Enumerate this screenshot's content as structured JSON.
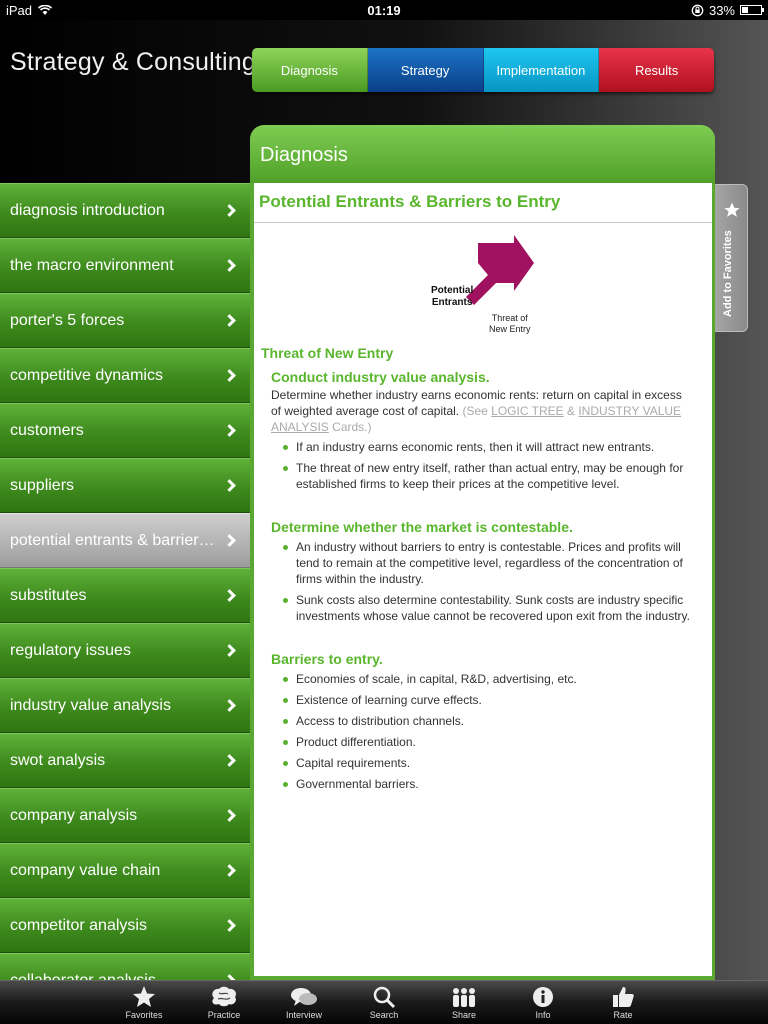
{
  "status": {
    "device": "iPad",
    "time": "01:19",
    "battery": "33%",
    "battery_level": 0.33
  },
  "header": {
    "title": "Strategy & Consulting"
  },
  "tabs": [
    {
      "label": "Diagnosis",
      "color": "green"
    },
    {
      "label": "Strategy",
      "color": "blue"
    },
    {
      "label": "Implementation",
      "color": "cyan"
    },
    {
      "label": "Results",
      "color": "red"
    }
  ],
  "panel": {
    "heading": "Diagnosis"
  },
  "sidebar": {
    "items": [
      {
        "label": "diagnosis introduction"
      },
      {
        "label": "the macro environment"
      },
      {
        "label": "porter's 5 forces"
      },
      {
        "label": "competitive dynamics"
      },
      {
        "label": "customers"
      },
      {
        "label": "suppliers"
      },
      {
        "label": "potential entrants & barrier…",
        "active": true
      },
      {
        "label": "substitutes"
      },
      {
        "label": "regulatory issues"
      },
      {
        "label": "industry value analysis"
      },
      {
        "label": "swot analysis"
      },
      {
        "label": "company analysis"
      },
      {
        "label": "company value chain"
      },
      {
        "label": "competitor analysis"
      },
      {
        "label": "collaborator analysis"
      }
    ]
  },
  "content": {
    "title": "Potential Entrants & Barriers to Entry",
    "figure": {
      "label_main": [
        "Potential",
        "Entrants"
      ],
      "label_arrow": [
        "Threat of",
        "New Entry"
      ]
    },
    "section": "Threat of New Entry",
    "s1": {
      "heading": "Conduct industry value analysis.",
      "text": "Determine whether industry earns economic rents: return on capital in excess of weighted average cost of capital.",
      "see_prefix": "(See",
      "link1": "LOGIC TREE",
      "amp": "&",
      "link2": "INDUSTRY VALUE ANALYSIS",
      "see_suffix": "Cards.)",
      "bullets": [
        "If an industry earns economic rents, then it will attract new entrants.",
        "The threat of new entry itself, rather than actual entry, may be enough for established firms to keep their prices at the competitive level."
      ]
    },
    "s2": {
      "heading": "Determine whether the market is contestable.",
      "bullets": [
        "An industry without barriers to entry is contestable. Prices and profits will tend to remain at the competitive level, regardless of the concentration of firms within the industry.",
        "Sunk costs also determine contestability. Sunk costs are industry specific investments whose value cannot be recovered upon exit from the industry."
      ]
    },
    "s3": {
      "heading": "Barriers to entry.",
      "bullets": [
        "Economies of scale, in capital, R&D, advertising, etc.",
        "Existence of learning curve effects.",
        "Access to distribution channels.",
        "Product differentiation.",
        "Capital requirements.",
        "Governmental barriers."
      ]
    }
  },
  "favorites_tab": {
    "label": "Add to Favorites"
  },
  "toolbar": {
    "items": [
      {
        "label": "Favorites",
        "icon": "star-icon"
      },
      {
        "label": "Practice",
        "icon": "brain-icon"
      },
      {
        "label": "Interview",
        "icon": "speech-bubbles-icon"
      },
      {
        "label": "Search",
        "icon": "search-icon"
      },
      {
        "label": "Share",
        "icon": "people-icon"
      },
      {
        "label": "Info",
        "icon": "info-icon"
      },
      {
        "label": "Rate",
        "icon": "thumbs-up-icon"
      }
    ]
  },
  "colors": {
    "accent_green": "#59b62d",
    "figure_arrow": "#a0125f"
  }
}
